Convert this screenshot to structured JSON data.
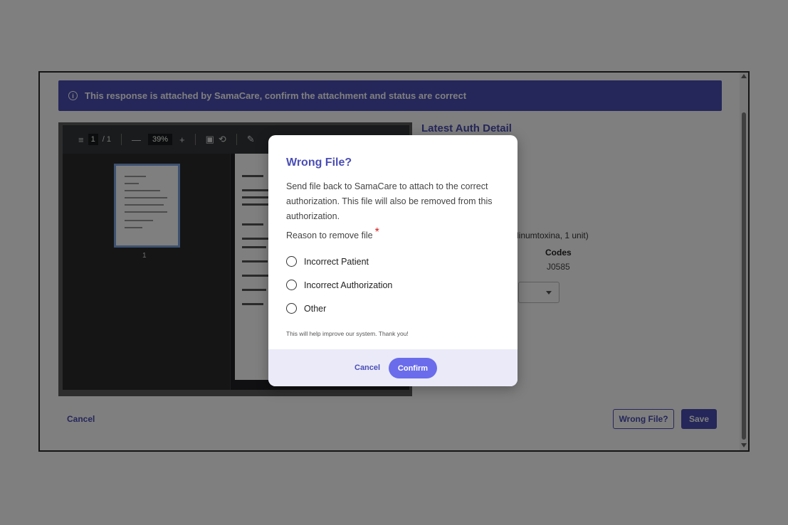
{
  "banner": {
    "icon": "info-icon",
    "text": "This response is attached by SamaCare, confirm the attachment and status are correct"
  },
  "pdf": {
    "page_current": "1",
    "page_total": "/ 1",
    "zoom": "39%",
    "zoom_out": "—",
    "zoom_in": "+",
    "thumb_number": "1"
  },
  "right_panel": {
    "title": "Latest Auth Detail",
    "drug_text": "linumtoxina, 1 unit)",
    "codes_header": "Codes",
    "codes_value": "J0585"
  },
  "footer": {
    "cancel_label": "Cancel",
    "wrong_file_label": "Wrong File?",
    "save_label": "Save"
  },
  "modal": {
    "title": "Wrong File?",
    "description": "Send file back to SamaCare to attach to the correct authorization. This file will also be removed from this authorization.",
    "reason_label": "Reason to remove file",
    "required_mark": "*",
    "options": [
      "Incorrect Patient",
      "Incorrect Authorization",
      "Other"
    ],
    "note": "This will help improve our system. Thank you!",
    "cancel_label": "Cancel",
    "confirm_label": "Confirm"
  },
  "colors": {
    "brand": "#4b4eb5",
    "confirm": "#6a6ceb",
    "footer_bg": "#eaeaf9",
    "required": "#d32020"
  }
}
